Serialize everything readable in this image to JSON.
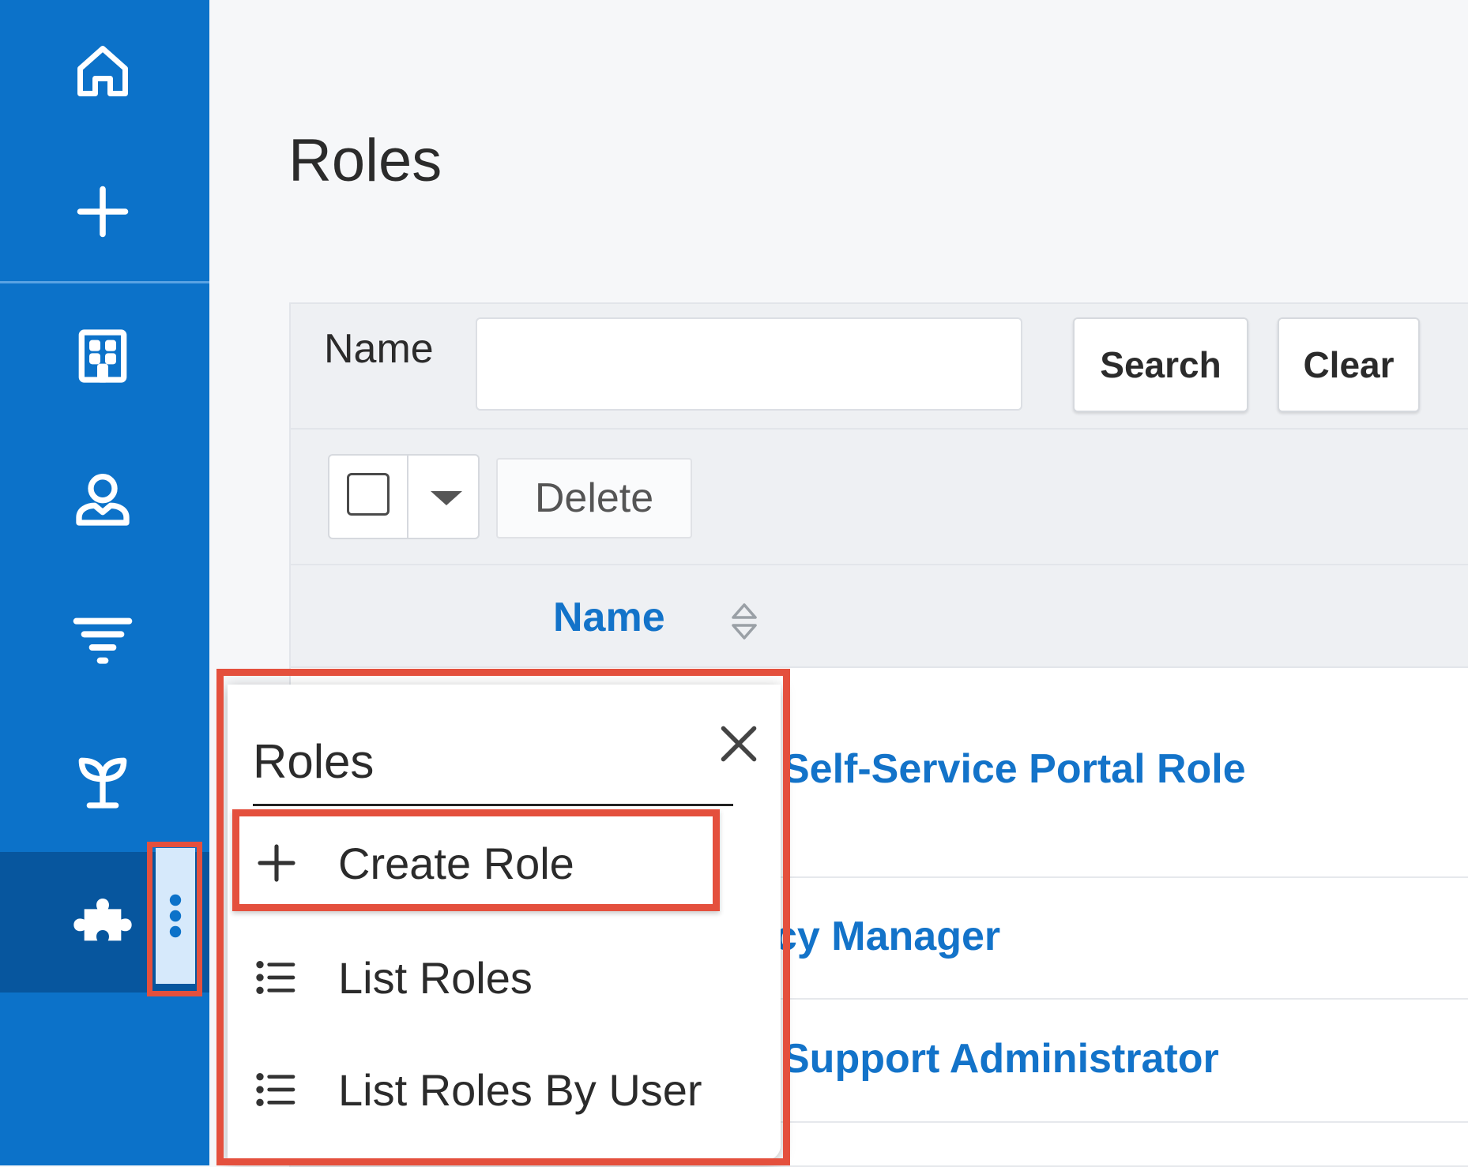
{
  "sidebar": {
    "items": [
      {
        "icon": "home-icon"
      },
      {
        "icon": "plus-icon"
      },
      {
        "icon": "building-icon"
      },
      {
        "icon": "user-icon"
      },
      {
        "icon": "filter-icon"
      },
      {
        "icon": "sprout-icon"
      },
      {
        "icon": "puzzle-icon",
        "active": true
      }
    ],
    "more_icon": "kebab-vertical-icon"
  },
  "page": {
    "title": "Roles"
  },
  "filter": {
    "label": "Name",
    "value": "",
    "placeholder": "",
    "search_label": "Search",
    "clear_label": "Clear"
  },
  "actions": {
    "delete_label": "Delete"
  },
  "table": {
    "columns": [
      "Name"
    ],
    "rows": [
      {
        "name": "Self-Service Portal Role"
      },
      {
        "name": "cy Manager"
      },
      {
        "name": "Support Administrator"
      }
    ]
  },
  "popup": {
    "title": "Roles",
    "items": [
      {
        "label": "Create Role",
        "icon": "plus-icon"
      },
      {
        "label": "List Roles",
        "icon": "list-icon"
      },
      {
        "label": "List Roles By User",
        "icon": "list-icon"
      }
    ]
  },
  "colors": {
    "sidebar": "#0c72c9",
    "sidebar_active": "#07569e",
    "link": "#1373c9",
    "highlight": "#e4503d"
  }
}
